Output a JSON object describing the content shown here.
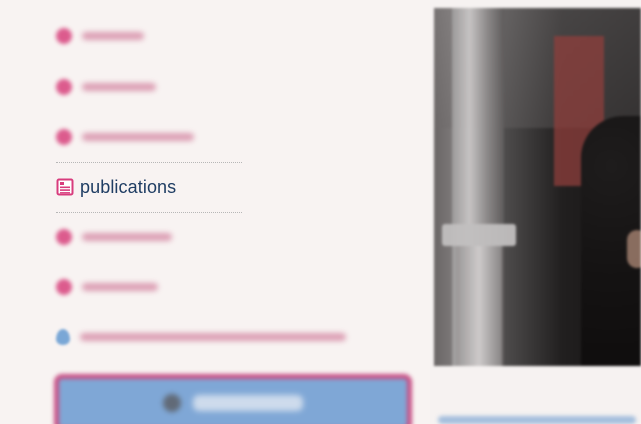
{
  "nav": {
    "active_label": "publications",
    "accent_colors": {
      "pink": "#d94b83",
      "navy": "#1f3d63",
      "blue": "#7fa7d6",
      "magenta_border": "#c85085"
    }
  },
  "icons": {
    "active": "publications-icon",
    "cta": "user-icon",
    "marker": "location-pin-icon"
  }
}
